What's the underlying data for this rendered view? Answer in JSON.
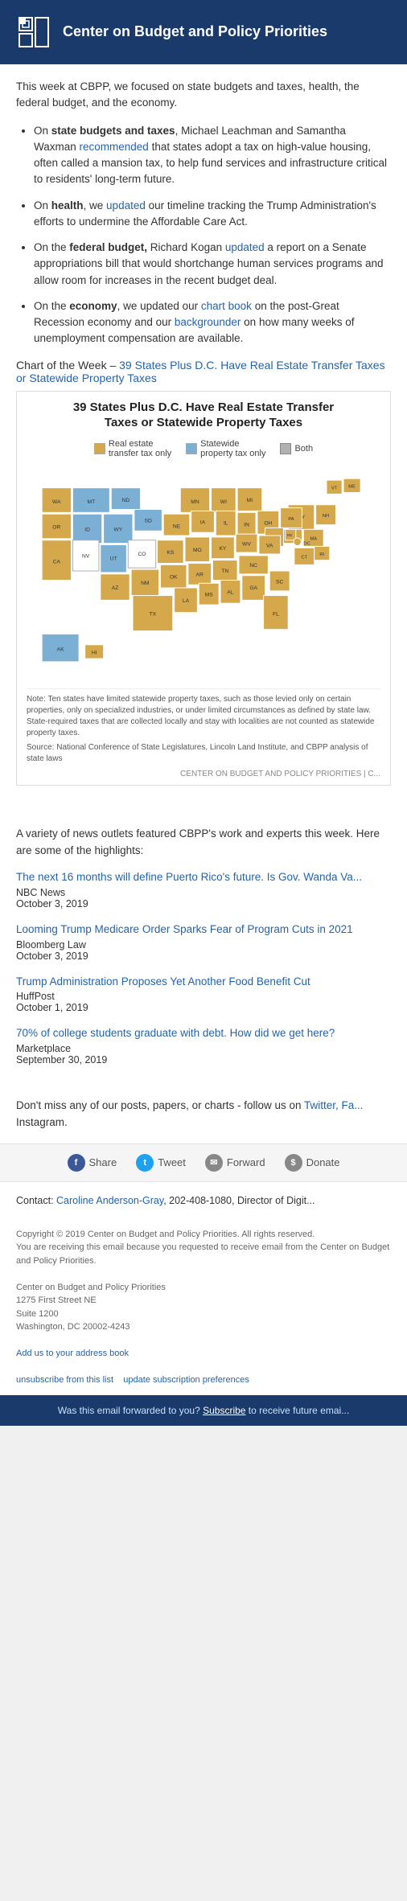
{
  "header": {
    "logo_alt": "CBPP Logo",
    "title": "Center on Budget and Policy Priorities"
  },
  "intro": {
    "text": "This week at CBPP, we focused on state budgets and taxes, health, the federal budget, and the economy."
  },
  "bullets": [
    {
      "id": "state-budgets",
      "bold": "state budgets and taxes",
      "prefix": "On ",
      "text": ", Michael Leachman and Samantha Waxman ",
      "link_text": "recommended",
      "link_href": "#",
      "suffix": " that states adopt a tax on high-value housing, often called a mansion tax, to help fund services and infrastructure critical to residents' long-term future."
    },
    {
      "id": "health",
      "bold": "health",
      "prefix": "On ",
      "text": ", we ",
      "link_text": "updated",
      "link_href": "#",
      "suffix": " our timeline tracking the Trump Administration's efforts to undermine the Affordable Care Act."
    },
    {
      "id": "federal-budget",
      "bold": "federal budget,",
      "prefix": "On the ",
      "text": " Richard Kogan ",
      "link_text": "updated",
      "link_href": "#",
      "suffix": " a report on a Senate appropriations bill that would shortchange human services programs and allow room for increases in the recent budget deal."
    },
    {
      "id": "economy",
      "bold": "economy",
      "prefix": "On the ",
      "text": ", we updated our ",
      "link_text1": "chart book",
      "link_href1": "#",
      "text2": " on the post-Great Recession economy and our ",
      "link_text2": "backgrounder",
      "link_href2": "#",
      "suffix": " on how many weeks of unemployment compensation are available."
    }
  ],
  "chart": {
    "prefix": "Chart of the Week – ",
    "link_text": "39 States Plus D.C. Have Real Estate Transfer Taxes or Statewide Property Taxes",
    "link_href": "#",
    "box_title": "39 States Plus D.C. Have Real Estate Transfer\nTaxes or Statewide Property Taxes",
    "legend": [
      {
        "id": "real-estate",
        "label": "Real estate\ntransfer tax only",
        "color": "#d4a84b"
      },
      {
        "id": "statewide",
        "label": "Statewide\nproperty tax only",
        "color": "#7bafd4"
      },
      {
        "id": "both",
        "label": "Both",
        "color": "#c0c0c0"
      }
    ],
    "note": "Note: Ten states have limited statewide property taxes, such as those levied only on certain properties, only on specialized industries, or under limited circumstances as defined by state law. State-required taxes that are collected locally and stay with localities are not counted as statewide property taxes.",
    "source": "Source: National Conference of State Legislatures, Lincoln Land Institute, and CBPP analysis of state laws",
    "attribution": "CENTER ON BUDGET AND POLICY PRIORITIES | C..."
  },
  "news": {
    "intro": "A variety of news outlets featured CBPP's work and experts this week. Here are some of the highlights:",
    "items": [
      {
        "title": "The next 16 months will define Puerto Rico's future. Is Gov. Wanda Va...",
        "source": "NBC News",
        "date": "October 3, 2019",
        "href": "#"
      },
      {
        "title": "Looming Trump Medicare Order Sparks Fear of Program Cuts in 2021",
        "source": "Bloomberg Law",
        "date": "October 3, 2019",
        "href": "#"
      },
      {
        "title": "Trump Administration Proposes Yet Another Food Benefit Cut",
        "source": "HuffPost",
        "date": "October 1, 2019",
        "href": "#"
      },
      {
        "title": "70% of college students graduate with debt. How did we get here?",
        "source": "Marketplace",
        "date": "September 30, 2019",
        "href": "#"
      }
    ]
  },
  "follow": {
    "text_prefix": "Don't miss any of our posts, papers, or charts - follow us on ",
    "link1_text": "Twitter, Fa...",
    "link1_href": "#",
    "text_suffix": " Instagram."
  },
  "social": {
    "share_label": "Share",
    "tweet_label": "Tweet",
    "forward_label": "Forward",
    "donate_label": "Donate"
  },
  "contact": {
    "label": "Contact: ",
    "name": "Caroline Anderson-Gray",
    "name_href": "#",
    "detail": ", 202-408-1080, Director of Digit..."
  },
  "copyright": {
    "line1": "Copyright © 2019 Center on Budget and Policy Priorities. All rights reserved.",
    "line2": "You are receiving this email because you requested to receive email from the Center on Budget and Policy Priorities.",
    "org_name": "Center on Budget and Policy Priorities",
    "address1": "1275 First Street NE",
    "address2": "Suite 1200",
    "address3": "Washington, DC 20002-4243",
    "add_address_text": "Add us to your address book",
    "add_address_href": "#",
    "unsubscribe_text": "unsubscribe from this list",
    "unsubscribe_href": "#",
    "update_text": "update subscription preferences",
    "update_href": "#"
  },
  "footer": {
    "text": "Was this email forwarded to you? ",
    "subscribe_text": "Subscribe",
    "subscribe_href": "#",
    "text_suffix": " to receive future emai..."
  }
}
